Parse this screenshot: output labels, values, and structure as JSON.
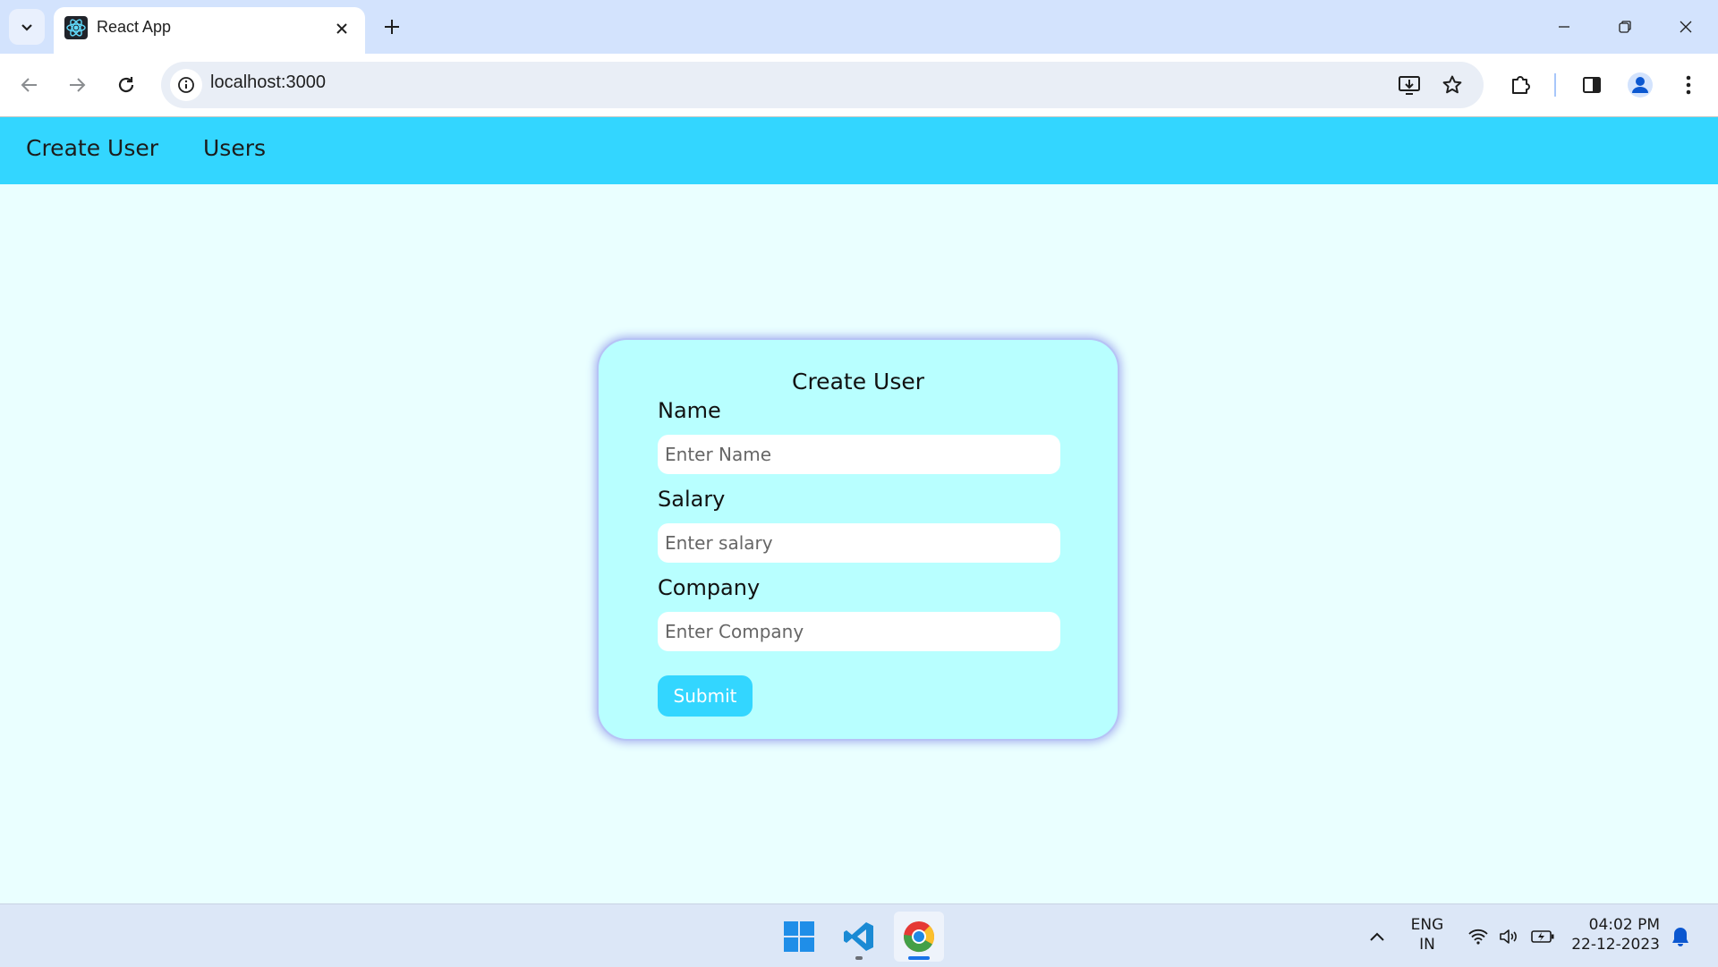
{
  "browser": {
    "tab_title": "React App",
    "url": "localhost:3000"
  },
  "nav": {
    "links": [
      "Create User",
      "Users"
    ]
  },
  "form": {
    "title": "Create User",
    "fields": [
      {
        "label": "Name",
        "placeholder": "Enter Name"
      },
      {
        "label": "Salary",
        "placeholder": "Enter salary"
      },
      {
        "label": "Company",
        "placeholder": "Enter Company"
      }
    ],
    "submit_label": "Submit"
  },
  "taskbar": {
    "language_line1": "ENG",
    "language_line2": "IN",
    "time": "04:02 PM",
    "date": "22-12-2023"
  },
  "colors": {
    "page_bg": "#eaffff",
    "nav_bg": "#33d6ff",
    "card_bg": "#b8ffff",
    "button_bg": "#33d6ff"
  }
}
